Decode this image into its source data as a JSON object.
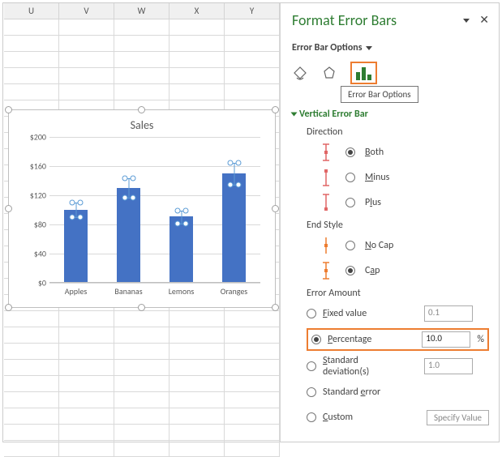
{
  "columns": [
    "U",
    "V",
    "W",
    "X",
    "Y"
  ],
  "panel": {
    "title": "Format Error Bars",
    "subhead": "Error Bar Options",
    "tooltip": "Error Bar Options",
    "section": "Vertical Error Bar",
    "grp_direction": "Direction",
    "direction": {
      "both": "Both",
      "minus": "Minus",
      "plus": "Plus",
      "selected": "both"
    },
    "grp_endstyle": "End Style",
    "endstyle": {
      "nocap": "No Cap",
      "cap": "Cap",
      "selected": "cap"
    },
    "grp_amount": "Error Amount",
    "amount": {
      "fixed_label": "Fixed value",
      "fixed_value": "0.1",
      "percentage_label": "Percentage",
      "percentage_value": "10.0",
      "percentage_unit": "%",
      "stddev_label": "Standard deviation(s)",
      "stddev_value": "1.0",
      "stderr_label": "Standard error",
      "custom_label": "Custom",
      "custom_btn": "Specify Value",
      "selected": "percentage"
    }
  },
  "chart_data": {
    "type": "bar",
    "title": "Sales",
    "categories": [
      "Apples",
      "Bananas",
      "Lemons",
      "Oranges"
    ],
    "values": [
      100,
      130,
      90,
      150
    ],
    "error_percent": 10.0,
    "ylabel": "",
    "xlabel": "",
    "yticks": [
      "$0",
      "$40",
      "$80",
      "$120",
      "$160",
      "$200"
    ],
    "ylim": [
      0,
      200
    ]
  }
}
